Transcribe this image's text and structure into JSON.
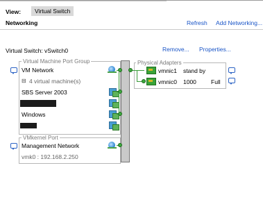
{
  "view": {
    "label": "View:",
    "selected": "Virtual Switch"
  },
  "section_title": "Networking",
  "toolbar": {
    "refresh": "Refresh",
    "add_networking": "Add Networking..."
  },
  "vswitch": {
    "label": "Virtual Switch: vSwitch0",
    "remove": "Remove...",
    "properties": "Properties..."
  },
  "vm_port_group": {
    "title": "Virtual Machine Port Group",
    "name": "VM Network",
    "count": "4 virtual machine(s)",
    "vms": [
      "SBS Server 2003",
      "",
      "Windows",
      ""
    ]
  },
  "physical_adapters": {
    "title": "Physical Adapters",
    "adapters": [
      {
        "name": "vmnic1",
        "speed": "",
        "status": "stand by"
      },
      {
        "name": "vmnic0",
        "speed": "1000",
        "status": "Full"
      }
    ]
  },
  "vmkernel_port": {
    "title": "VMkernel Port",
    "name": "Management Network",
    "ip": "vmk0 : 192.168.2.250"
  },
  "colors": {
    "link": "#1a55c7",
    "connector": "#3a9b3a"
  }
}
